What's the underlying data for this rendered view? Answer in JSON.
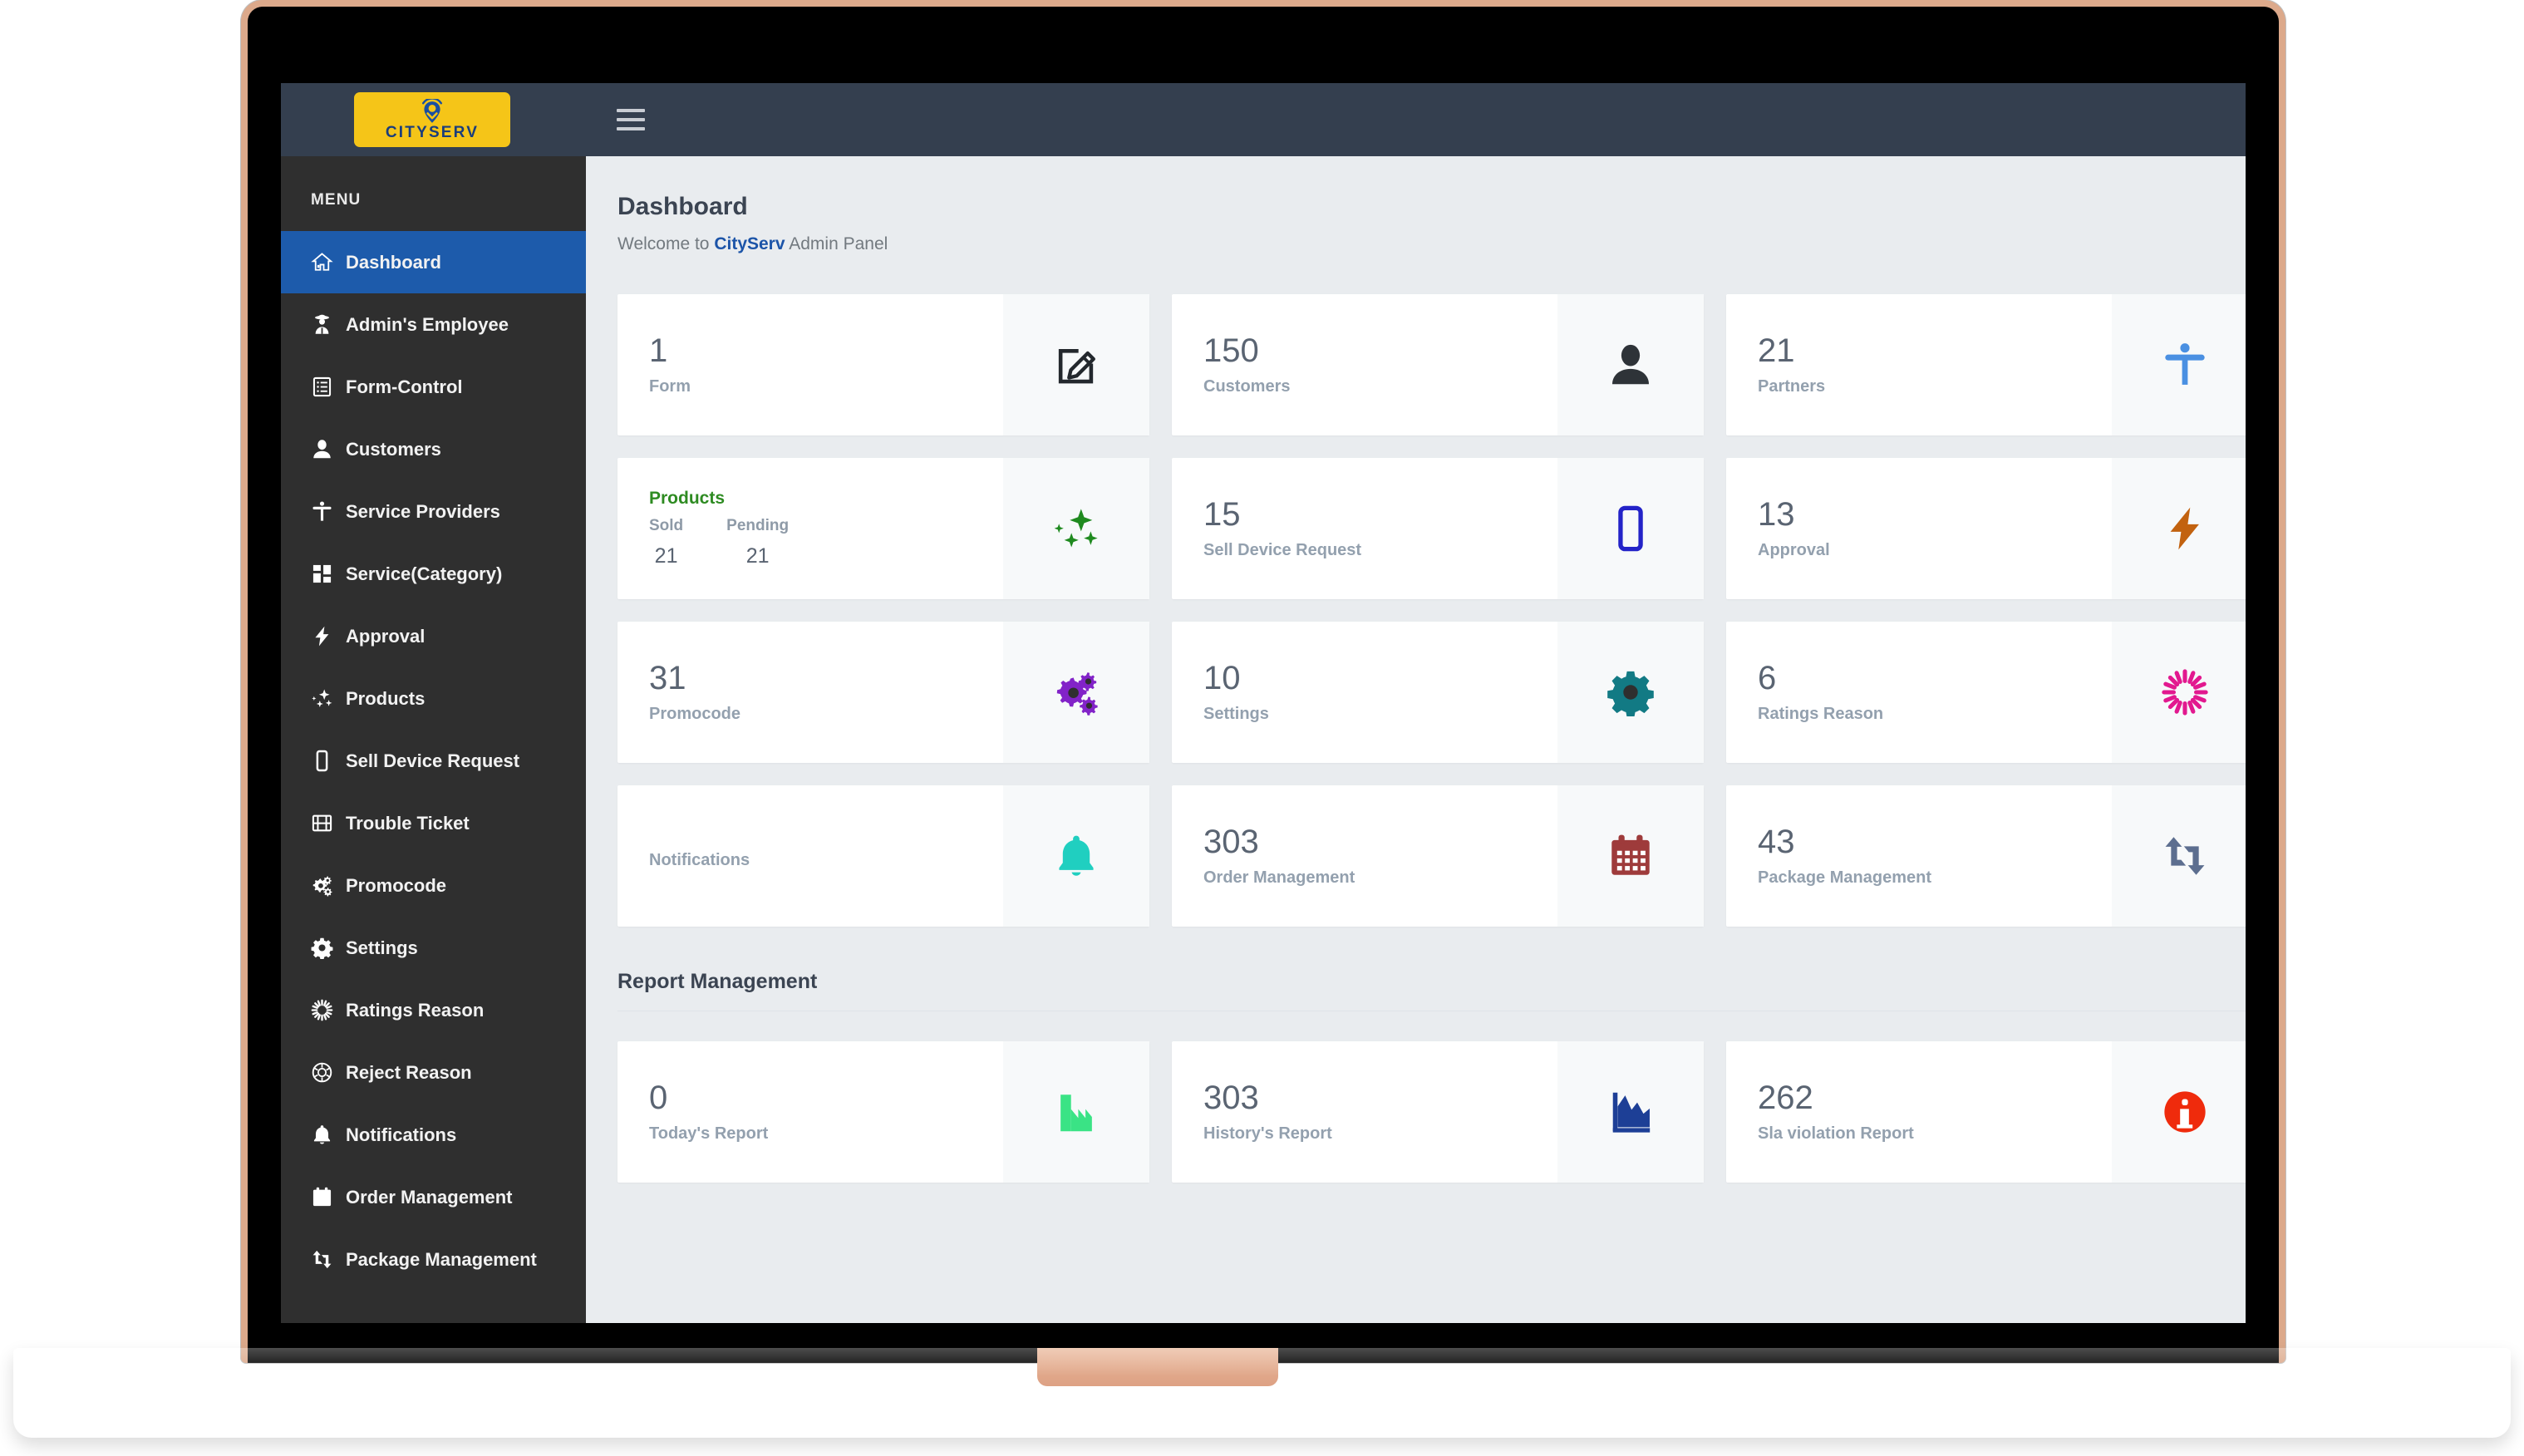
{
  "brand": {
    "wordmark": "CITYSERV",
    "logo_bg": "#f5c518",
    "logo_mark": "location-pin"
  },
  "topbar": {
    "menu_toggle": "hamburger-menu"
  },
  "sidebar": {
    "heading": "MENU",
    "items": [
      {
        "label": "Dashboard",
        "icon": "home-icon",
        "active": true
      },
      {
        "label": "Admin's Employee",
        "icon": "secret-agent-icon",
        "active": false
      },
      {
        "label": "Form-Control",
        "icon": "form-list-icon",
        "active": false
      },
      {
        "label": "Customers",
        "icon": "user-icon",
        "active": false
      },
      {
        "label": "Service Providers",
        "icon": "accessibility-icon",
        "active": false
      },
      {
        "label": "Service(Category)",
        "icon": "grid-icon",
        "active": false
      },
      {
        "label": "Approval",
        "icon": "bolt-icon",
        "active": false
      },
      {
        "label": "Products",
        "icon": "sparkles-icon",
        "active": false
      },
      {
        "label": "Sell Device Request",
        "icon": "mobile-icon",
        "active": false
      },
      {
        "label": "Trouble Ticket",
        "icon": "film-icon",
        "active": false
      },
      {
        "label": "Promocode",
        "icon": "cogs-icon",
        "active": false
      },
      {
        "label": "Settings",
        "icon": "gear-icon",
        "active": false
      },
      {
        "label": "Ratings Reason",
        "icon": "sunburst-icon",
        "active": false
      },
      {
        "label": "Reject Reason",
        "icon": "aperture-icon",
        "active": false
      },
      {
        "label": "Notifications",
        "icon": "bell-icon",
        "active": false
      },
      {
        "label": "Order Management",
        "icon": "calendar-icon",
        "active": false
      },
      {
        "label": "Package Management",
        "icon": "retweet-icon",
        "active": false
      }
    ]
  },
  "main": {
    "title": "Dashboard",
    "welcome_prefix": "Welcome to ",
    "welcome_brand": "CityServ",
    "welcome_suffix": " Admin Panel",
    "stats": [
      {
        "value": "1",
        "label": "Form",
        "icon": "edit-square-icon",
        "color": "#23282d"
      },
      {
        "value": "150",
        "label": "Customers",
        "icon": "user-icon",
        "color": "#2e3338"
      },
      {
        "value": "21",
        "label": "Partners",
        "icon": "accessibility-icon",
        "color": "#4a90e2"
      },
      {
        "value": "",
        "label": "Products",
        "icon": "sparkles-icon",
        "color": "#1f8a1f",
        "variant": "products",
        "title": "Products",
        "sub": [
          {
            "head": "Sold",
            "num": "21"
          },
          {
            "head": "Pending",
            "num": "21"
          }
        ]
      },
      {
        "value": "15",
        "label": "Sell Device Request",
        "icon": "mobile-icon",
        "color": "#2323c8"
      },
      {
        "value": "13",
        "label": "Approval",
        "icon": "bolt-icon",
        "color": "#c2620f"
      },
      {
        "value": "31",
        "label": "Promocode",
        "icon": "cogs-icon",
        "color": "#8223c8"
      },
      {
        "value": "10",
        "label": "Settings",
        "icon": "gear-icon",
        "color": "#127a84"
      },
      {
        "value": "6",
        "label": "Ratings Reason",
        "icon": "sunburst-icon",
        "color": "#e2198f"
      },
      {
        "value": "",
        "label": "Notifications",
        "icon": "bell-icon",
        "color": "#20cfc0"
      },
      {
        "value": "303",
        "label": "Order Management",
        "icon": "calendar-icon",
        "color": "#9e3b3b"
      },
      {
        "value": "43",
        "label": "Package Management",
        "icon": "retweet-icon",
        "color": "#5c6e8f"
      }
    ],
    "report_section_title": "Report Management",
    "reports": [
      {
        "value": "0",
        "label": "Today's Report",
        "icon": "factory-chart-icon",
        "color": "#3ae385"
      },
      {
        "value": "303",
        "label": "History's Report",
        "icon": "area-chart-icon",
        "color": "#1d3f96"
      },
      {
        "value": "262",
        "label": "Sla violation Report",
        "icon": "info-circle-icon",
        "color": "#ef2b0c"
      }
    ]
  }
}
